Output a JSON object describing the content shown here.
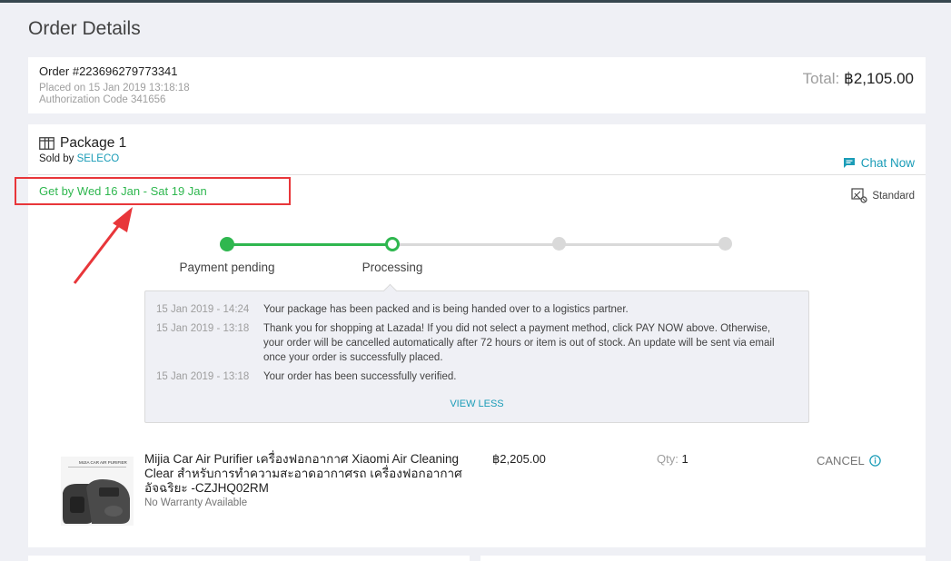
{
  "page": {
    "title": "Order Details"
  },
  "order": {
    "number": "Order #223696279773341",
    "placed": "Placed on 15 Jan 2019 13:18:18",
    "auth": "Authorization Code 341656",
    "total_label": "Total: ",
    "total_value": "฿2,105.00"
  },
  "package": {
    "title": "Package 1",
    "sold_by_label": "Sold by ",
    "seller": "SELECO",
    "chat_now": "Chat Now",
    "get_by": "Get by Wed 16 Jan - Sat 19 Jan",
    "shipping": "Standard",
    "steps": [
      {
        "label": "Payment pending",
        "state": "done"
      },
      {
        "label": "Processing",
        "state": "current"
      },
      {
        "label": "",
        "state": "pending"
      },
      {
        "label": "",
        "state": "pending"
      }
    ],
    "logs": [
      {
        "time": "15 Jan 2019 - 14:24",
        "text": "Your package has been packed and is being handed over to a logistics partner."
      },
      {
        "time": "15 Jan 2019 - 13:18",
        "text": "Thank you for shopping at Lazada! If you did not select a payment method, click PAY NOW above. Otherwise, your order will be cancelled automatically after 72 hours or item is out of stock. An update will be sent via email once your order is successfully placed."
      },
      {
        "time": "15 Jan 2019 - 13:18",
        "text": "Your order has been successfully verified."
      }
    ],
    "view_less": "VIEW LESS",
    "item": {
      "image_caption": "MIJIA CAR AIR PURIFIER",
      "name": "Mijia Car Air Purifier เครื่องฟอกอากาศ Xiaomi Air Cleaning Clear สำหรับการทำความสะอาดอากาศรถ เครื่องฟอกอากาศอัจฉริยะ -CZJHQ02RM",
      "warranty": "No Warranty Available",
      "price": "฿2,205.00",
      "qty_label": "Qty: ",
      "qty": "1",
      "cancel": "CANCEL"
    }
  },
  "colors": {
    "accent": "#1a9cb7",
    "success": "#2fb74f",
    "annotation": "#e8363a",
    "inactive": "#d9d9d9"
  }
}
